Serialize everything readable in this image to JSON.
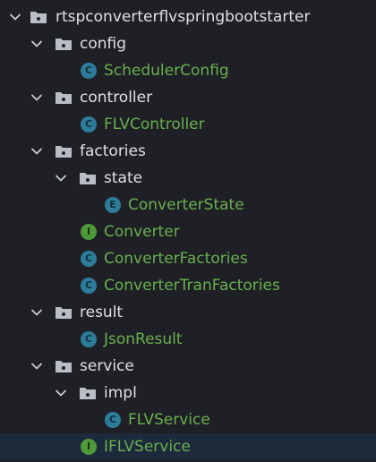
{
  "tree": {
    "root": {
      "label": "rtspconverterflvspringbootstarter",
      "expanded": true
    },
    "config": {
      "label": "config",
      "items": [
        {
          "label": "SchedulerConfig",
          "kind": "C"
        }
      ]
    },
    "controller": {
      "label": "controller",
      "items": [
        {
          "label": "FLVController",
          "kind": "C"
        }
      ]
    },
    "factories": {
      "label": "factories",
      "state": {
        "label": "state",
        "items": [
          {
            "label": "ConverterState",
            "kind": "E"
          }
        ]
      },
      "items": [
        {
          "label": "Converter",
          "kind": "I"
        },
        {
          "label": "ConverterFactories",
          "kind": "C"
        },
        {
          "label": "ConverterTranFactories",
          "kind": "C"
        }
      ]
    },
    "result": {
      "label": "result",
      "items": [
        {
          "label": "JsonResult",
          "kind": "C"
        }
      ]
    },
    "service": {
      "label": "service",
      "impl": {
        "label": "impl",
        "items": [
          {
            "label": "FLVService",
            "kind": "C"
          }
        ]
      },
      "items": [
        {
          "label": "IFLVService",
          "kind": "I"
        }
      ]
    },
    "selected": "IFLVService"
  },
  "colors": {
    "background": "#1e2025",
    "selection": "#1d2a3b",
    "package_text": "#dfe1e5",
    "class_text": "#6aaf50",
    "class_badge": "#2c7c9a",
    "interface_badge": "#4e9a3a",
    "folder_icon": "#b9bdc4"
  }
}
